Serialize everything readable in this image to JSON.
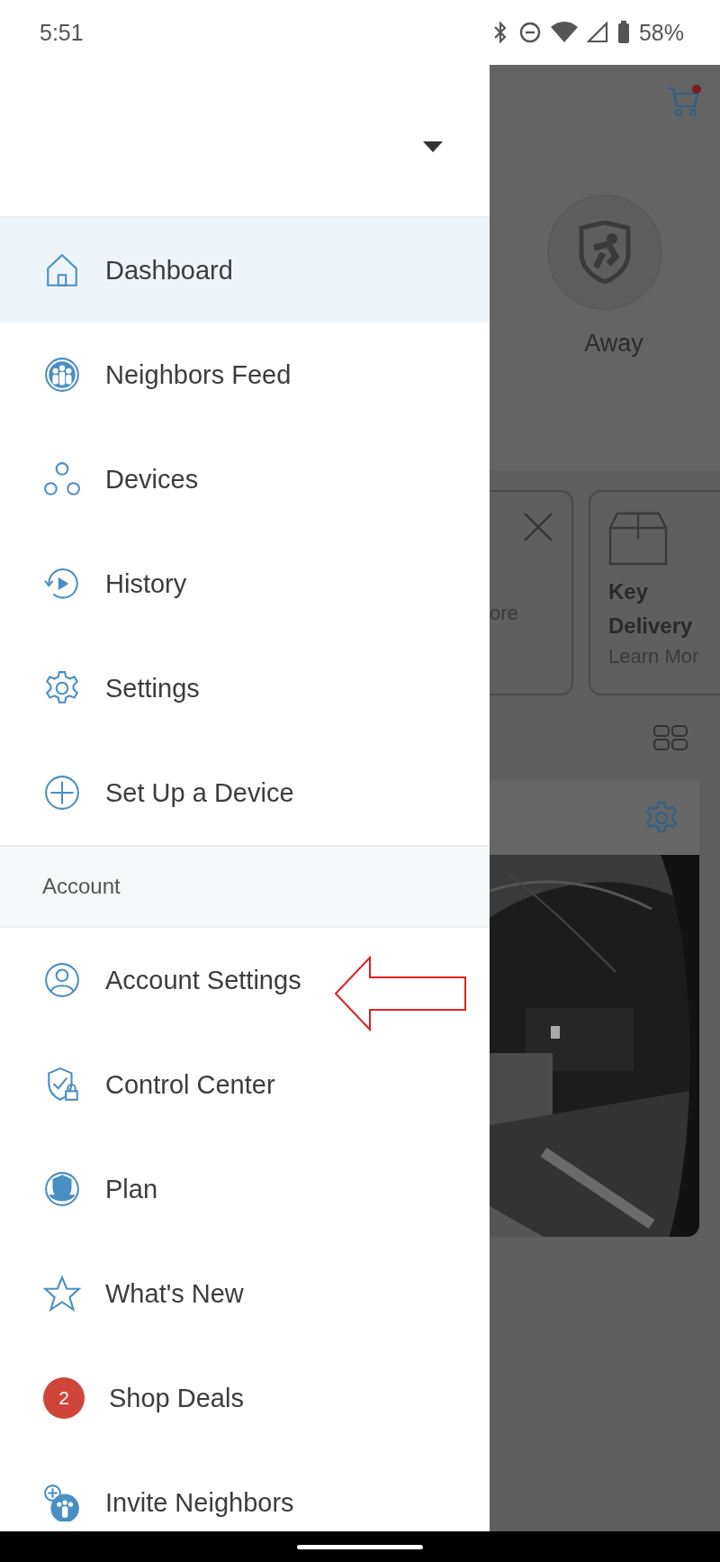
{
  "status_bar": {
    "time": "5:51",
    "battery": "58%"
  },
  "drawer": {
    "items": [
      {
        "label": "Dashboard",
        "selected": true
      },
      {
        "label": "Neighbors Feed",
        "selected": false
      },
      {
        "label": "Devices",
        "selected": false
      },
      {
        "label": "History",
        "selected": false
      },
      {
        "label": "Settings",
        "selected": false
      },
      {
        "label": "Set Up a Device",
        "selected": false
      }
    ],
    "account": {
      "title": "Account",
      "items": [
        {
          "label": "Account Settings",
          "selected": false
        },
        {
          "label": "Control Center",
          "selected": false
        },
        {
          "label": "Plan",
          "selected": false
        },
        {
          "label": "What's New",
          "selected": false
        },
        {
          "label": "Shop Deals",
          "selected": false,
          "badge": "2"
        },
        {
          "label": "Invite Neighbors",
          "selected": false
        }
      ]
    }
  },
  "background": {
    "mode": "Away",
    "cards": [
      {
        "link": "ore"
      },
      {
        "title": "Key Delivery",
        "link": "Learn Mor"
      }
    ]
  }
}
